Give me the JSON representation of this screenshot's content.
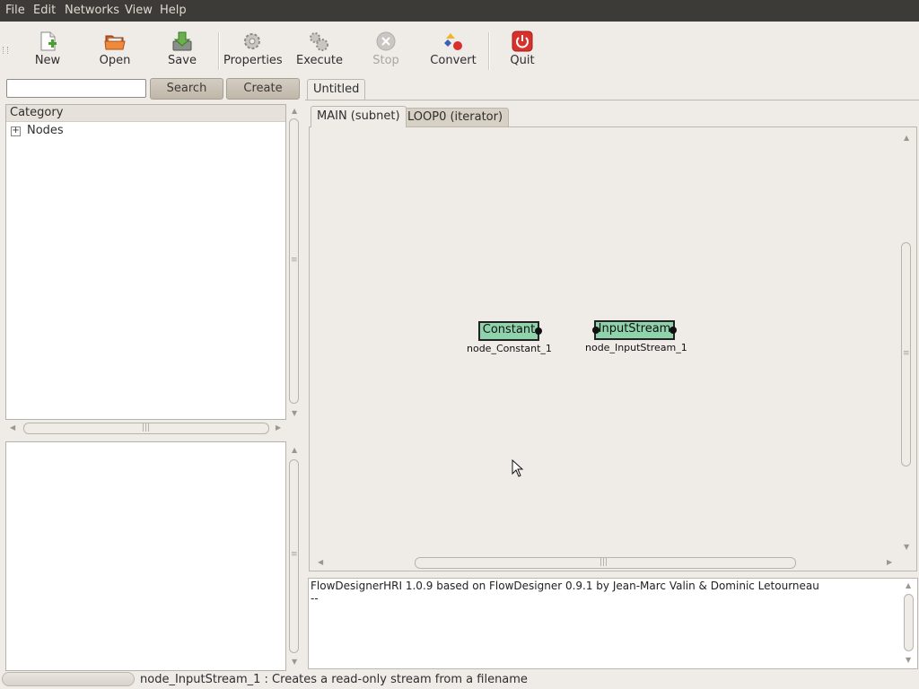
{
  "menu": [
    "File",
    "Edit",
    "Networks",
    "View",
    "Help"
  ],
  "toolbar": {
    "new": "New",
    "open": "Open",
    "save": "Save",
    "properties": "Properties",
    "execute": "Execute",
    "stop": "Stop",
    "convert": "Convert",
    "quit": "Quit"
  },
  "search": {
    "value": "",
    "search_button": "Search",
    "create_button": "Create"
  },
  "tree": {
    "header": "Category",
    "root": "Nodes"
  },
  "document_tab": "Untitled",
  "subnet_tabs": [
    "MAIN (subnet)",
    "LOOP0 (iterator)"
  ],
  "nodes": [
    {
      "type": "Constant",
      "name": "node_Constant_1"
    },
    {
      "type": "InputStream",
      "name": "node_InputStream_1"
    }
  ],
  "log": [
    "FlowDesignerHRI 1.0.9 based on FlowDesigner 0.9.1 by Jean-Marc Valin & Dominic Letourneau",
    "--"
  ],
  "status": "node_InputStream_1 : Creates a read-only stream from a filename",
  "colors": {
    "menubar": "#3c3b37",
    "node_fill": "#8fd3ac",
    "window_bg": "#efebe7",
    "quit_red": "#d9302c"
  }
}
